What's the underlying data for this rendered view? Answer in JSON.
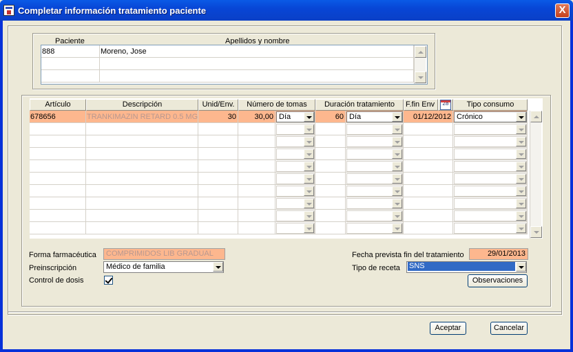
{
  "window": {
    "title": "Completar información tratamiento paciente",
    "close_glyph": "X"
  },
  "patient": {
    "headers": {
      "id": "Paciente",
      "name": "Apellidos y nombre"
    },
    "rows": [
      {
        "id": "888",
        "name": "Moreno, Jose"
      }
    ]
  },
  "treatment": {
    "headers": {
      "articulo": "Artículo",
      "descripcion": "Descripción",
      "unid": "Unid/Env.",
      "tomas": "Número de tomas",
      "duracion": "Duración tratamiento",
      "ffin": "F.fin Env",
      "calendar_glyph": "28",
      "tipo": "Tipo consumo"
    },
    "rows": [
      {
        "articulo": "678656",
        "descripcion": "TRANKIMAZIN RETARD 0.5 MG",
        "unid": "30",
        "tomas": "30,00",
        "tomas_unit": "Día",
        "duracion": "60",
        "duracion_unit": "Día",
        "ffin": "01/12/2012",
        "tipo": "Crónico"
      }
    ]
  },
  "form": {
    "forma_label": "Forma farmacéutica",
    "forma_value": "COMPRIMIDOS LIB GRADUAL",
    "preinscripcion_label": "Preinscripción",
    "preinscripcion_value": "Médico de familia",
    "control_label": "Control de dosis",
    "control_checked": true,
    "fecha_label": "Fecha prevista fin del tratamiento",
    "fecha_value": "29/01/2013",
    "receta_label": "Tipo de receta",
    "receta_value": "SNS",
    "observaciones_label": "Observaciones"
  },
  "buttons": {
    "aceptar": "Aceptar",
    "cancelar": "Cancelar"
  },
  "colors": {
    "highlight": "#fdb78e",
    "selection": "#316ac5",
    "title_bar": "#0a5ae6"
  }
}
